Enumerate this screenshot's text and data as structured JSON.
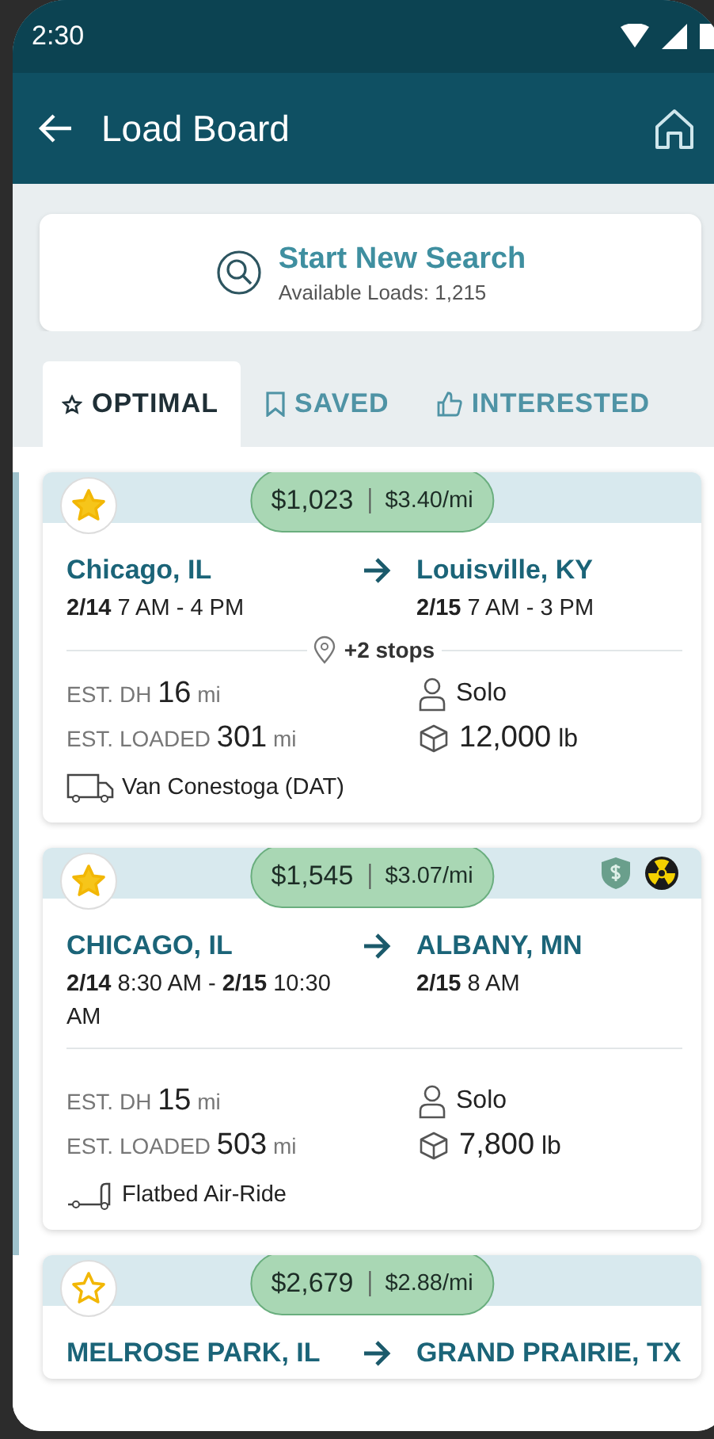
{
  "status_bar": {
    "time": "2:30"
  },
  "app_bar": {
    "title": "Load Board"
  },
  "search": {
    "title": "Start New Search",
    "subtitle": "Available Loads: 1,215"
  },
  "tabs": [
    {
      "kind": "star",
      "label": "OPTIMAL",
      "selected": true
    },
    {
      "kind": "bookmark",
      "label": "SAVED",
      "selected": false
    },
    {
      "kind": "thumb",
      "label": "INTERESTED",
      "selected": false
    }
  ],
  "loads": [
    {
      "starred": true,
      "highlighted": true,
      "price": "$1,023",
      "rate": "$3.40/mi",
      "origin": "Chicago, IL",
      "origin_time": "**2/14** 7 AM - 4 PM",
      "destination": "Louisville, KY",
      "destination_time": "**2/15** 7 AM - 3 PM",
      "stops": "+2 stops",
      "deadhead": "EST. DH **16** mi",
      "loaded": "EST. LOADED **301** mi",
      "team": "Solo",
      "weight": "**12,000** lb",
      "equipment": {
        "kind": "van",
        "label": "Van Conestoga (DAT)"
      }
    },
    {
      "starred": true,
      "highlighted": true,
      "price": "$1,545",
      "rate": "$3.07/mi",
      "badges": [
        {
          "kind": "shield"
        },
        {
          "kind": "hazmat"
        }
      ],
      "origin": "CHICAGO, IL",
      "origin_time": "**2/14** 8:30 AM - **2/15** 10:30 AM",
      "destination": "ALBANY, MN",
      "destination_time": "**2/15** 8 AM",
      "deadhead": "EST. DH **15** mi",
      "loaded": "EST. LOADED **503** mi",
      "team": "Solo",
      "weight": "**7,800** lb",
      "equipment": {
        "kind": "flatbed",
        "label": "Flatbed Air-Ride"
      }
    },
    {
      "starred": false,
      "highlighted": false,
      "price": "$2,679",
      "rate": "$2.88/mi",
      "origin": "MELROSE PARK, IL",
      "destination": "GRAND PRAIRIE, TX"
    }
  ]
}
